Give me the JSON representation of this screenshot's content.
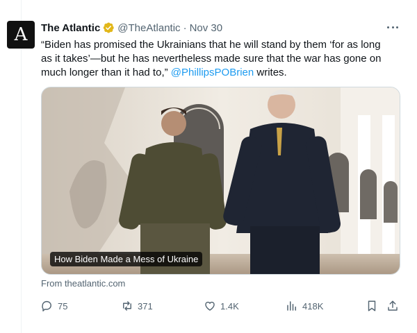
{
  "tweet": {
    "avatar_letter": "A",
    "author_name": "The Atlantic",
    "handle": "@TheAtlantic",
    "separator": "·",
    "date": "Nov 30",
    "text_before": "“Biden has promised the Ukrainians that he will stand by them ‘for as long as it takes’—but he has nevertheless made sure that the war has gone on much longer than it had to,” ",
    "mention": "@PhillipsPOBrien",
    "text_after": " writes."
  },
  "media": {
    "card_title": "How Biden Made a Mess of Ukraine",
    "source": "From theatlantic.com"
  },
  "actions": {
    "replies": "75",
    "reposts": "371",
    "likes": "1.4K",
    "views": "418K"
  },
  "colors": {
    "text": "#0f1419",
    "muted": "#536471",
    "accent": "#1d9bf0",
    "verified": "#e2b719"
  },
  "icons": [
    "verified-badge-icon",
    "more-icon",
    "reply-icon",
    "repost-icon",
    "like-icon",
    "views-icon",
    "bookmark-icon",
    "share-icon"
  ]
}
